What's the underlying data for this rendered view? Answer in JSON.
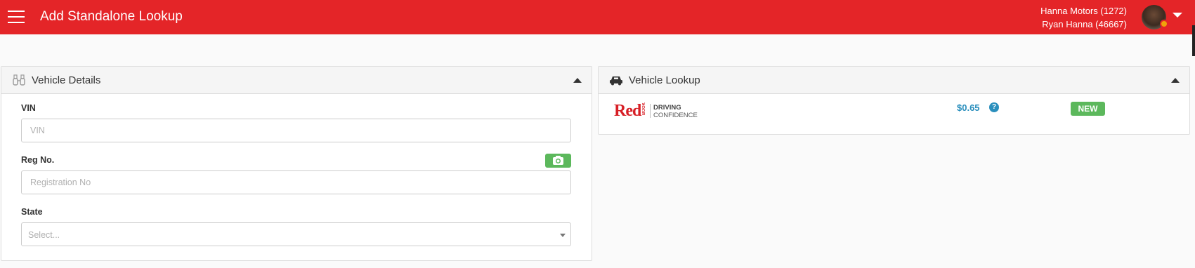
{
  "header": {
    "title": "Add Standalone Lookup",
    "dealer": "Hanna Motors (1272)",
    "user": "Ryan Hanna (46667)",
    "accent_color": "#e42528",
    "menu_icon": "hamburger-menu-icon",
    "user_menu_icon": "caret-down-icon"
  },
  "vehicle_details": {
    "title": "Vehicle Details",
    "icon": "binoculars-icon",
    "collapse_icon": "caret-up-icon",
    "vin": {
      "label": "VIN",
      "placeholder": "VIN",
      "value": ""
    },
    "reg": {
      "label": "Reg No.",
      "placeholder": "Registration No",
      "value": "",
      "camera_icon": "camera-icon"
    },
    "state": {
      "label": "State",
      "placeholder": "Select...",
      "value": ""
    }
  },
  "vehicle_lookup": {
    "title": "Vehicle Lookup",
    "icon": "car-icon",
    "collapse_icon": "caret-up-icon",
    "providers": [
      {
        "logo_word": "Red",
        "logo_sub": "BOOK",
        "tagline_1": "DRIVING",
        "tagline_2": "CONFIDENCE",
        "price": "$0.65",
        "help_icon": "question-circle-icon",
        "help_glyph": "?",
        "badge": "NEW",
        "badge_color": "#5cb85c"
      }
    ]
  }
}
